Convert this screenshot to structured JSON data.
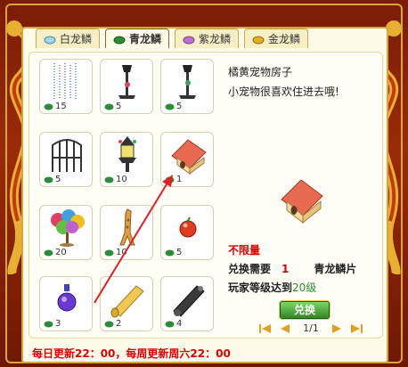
{
  "tabs": [
    {
      "label": "白龙鳞",
      "icon": "white-scale-icon",
      "color": "#9fd6e8"
    },
    {
      "label": "青龙鳞",
      "icon": "cyan-scale-icon",
      "color": "#2d8c3a"
    },
    {
      "label": "紫龙鳞",
      "icon": "purple-scale-icon",
      "color": "#c070d0"
    },
    {
      "label": "金龙鳞",
      "icon": "gold-scale-icon",
      "color": "#e0b020"
    }
  ],
  "items": [
    {
      "name": "light-curtain",
      "count": "15"
    },
    {
      "name": "street-lamp",
      "count": "5"
    },
    {
      "name": "street-lamp-green",
      "count": "5"
    },
    {
      "name": "iron-gate",
      "count": "5"
    },
    {
      "name": "ornate-lamp",
      "count": "10"
    },
    {
      "name": "orange-pet-house",
      "count": "1"
    },
    {
      "name": "flower-tree",
      "count": "20"
    },
    {
      "name": "giraffe",
      "count": "10"
    },
    {
      "name": "red-ball",
      "count": "5"
    },
    {
      "name": "potion-bottle",
      "count": "3"
    },
    {
      "name": "gold-scroll",
      "count": "2"
    },
    {
      "name": "black-cannon",
      "count": "4"
    }
  ],
  "detail": {
    "title": "橘黄宠物房子",
    "description": "小宠物很喜欢住进去哦!",
    "limit": "不限量",
    "requirement_label": "兑换需要",
    "requirement_count": "1",
    "requirement_item": "青龙鳞片",
    "level_label": "玩家等级达到",
    "level_value": "20级"
  },
  "exchange_button": "兑换",
  "pager": {
    "text": "1/1"
  },
  "footer": "每日更新22：00，每周更新周六22：00",
  "colors": {
    "accent_red": "#e00000",
    "button_green": "#3a9a2a",
    "frame": "#8a2208"
  }
}
